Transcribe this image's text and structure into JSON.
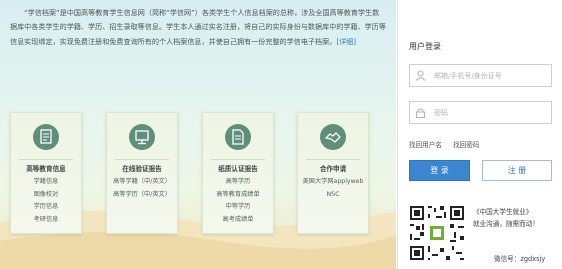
{
  "intro": {
    "text": "“学信档案”是中国高等教育学生信息网（简称“学信网”）各类学生个人信息档案的总称，涉及全国高等教育学生数据库中各类学生的学籍、学历、招生录取等信息。学生本人通过实名注册，将自己的实际身份与数据库中的学籍、学历等信息实现绑定，实现免费注册和免费查询所有的个人档案信息，并使自己拥有一份完整的学信电子档案。",
    "more_link": "[详细]"
  },
  "cards": [
    {
      "icon": "education-info-icon",
      "title": "高等教育信息",
      "items": [
        "学籍信息",
        "图像校对",
        "学历信息",
        "考研信息"
      ]
    },
    {
      "icon": "online-report-icon",
      "title": "在线验证报告",
      "items": [
        "高等学籍（中/英文）",
        "高等学历（中/英文）"
      ]
    },
    {
      "icon": "paper-cert-report-icon",
      "title": "纸质认证报告",
      "items": [
        "高等学历",
        "高等教育成绩单",
        "中等学历",
        "高考成绩单"
      ]
    },
    {
      "icon": "cooperation-handshake-icon",
      "title": "合作申请",
      "items": [
        "美国大学网applyweb",
        "NSC"
      ]
    }
  ],
  "login": {
    "title": "用户登录",
    "account_placeholder": "邮箱/手机号/身份证号",
    "password_placeholder": "密码",
    "find_username": "找回用户名",
    "find_password": "找回密码",
    "login_button": "登  录",
    "register_button": "注  册"
  },
  "wechat": {
    "line1": "《中国大学生就业》",
    "line2": "就业沟通，随需而动！",
    "id_label": "微信号：zgdxsjy"
  },
  "colors": {
    "accent": "#3a87cf",
    "card_icon": "#5f8f7a"
  }
}
